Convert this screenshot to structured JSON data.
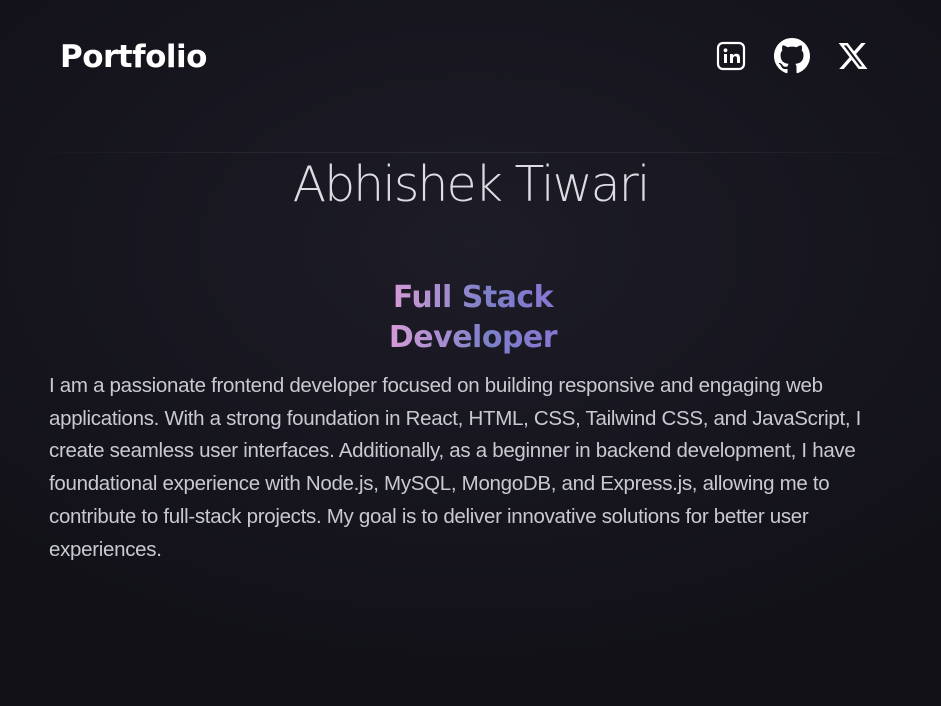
{
  "nav": {
    "logo": "Portfolio",
    "socials": [
      {
        "name": "LinkedIn",
        "icon": "linkedin-icon"
      },
      {
        "name": "GitHub",
        "icon": "github-icon"
      },
      {
        "name": "X",
        "icon": "x-icon"
      }
    ]
  },
  "hero": {
    "name": "Abhishek Tiwari",
    "role": "Full Stack Developer",
    "role_gradient": [
      "#f0a8d0",
      "#d39bd6",
      "#7b80c8",
      "#9a6be0"
    ],
    "bio": "I am a passionate frontend developer focused on building responsive and engaging web applications. With a strong foundation in React, HTML, CSS, Tailwind CSS, and JavaScript, I create seamless user interfaces. Additionally, as a beginner in backend development, I have foundational experience with Node.js, MySQL, MongoDB, and Express.js, allowing me to contribute to full-stack projects. My goal is to deliver innovative solutions for better user experiences."
  },
  "colors": {
    "background": "#17161f",
    "text_primary": "#ffffff",
    "text_body": "#c9c9d0"
  }
}
